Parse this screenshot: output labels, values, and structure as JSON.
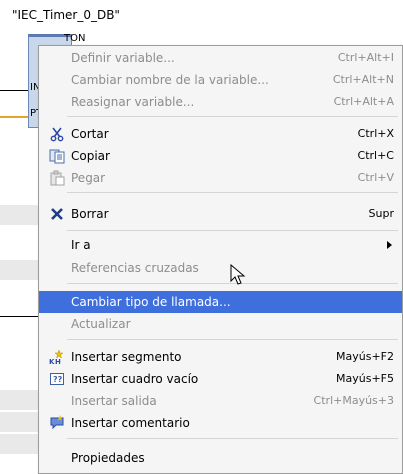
{
  "background": {
    "db_label": "\"IEC_Timer_0_DB\"",
    "block_title": "TON",
    "pin_in": "IN",
    "pin_pt": "PT"
  },
  "menu": {
    "items": [
      {
        "label": "Definir variable...",
        "shortcut": "Ctrl+Alt+I"
      },
      {
        "label": "Cambiar nombre de la variable...",
        "shortcut": "Ctrl+Alt+N"
      },
      {
        "label": "Reasignar variable...",
        "shortcut": "Ctrl+Alt+A"
      },
      {
        "label": "Cortar",
        "shortcut": "Ctrl+X"
      },
      {
        "label": "Copiar",
        "shortcut": "Ctrl+C"
      },
      {
        "label": "Pegar",
        "shortcut": "Ctrl+V"
      },
      {
        "label": "Borrar",
        "shortcut": "Supr"
      },
      {
        "label": "Ir a"
      },
      {
        "label": "Referencias cruzadas"
      },
      {
        "label": "Cambiar tipo de llamada..."
      },
      {
        "label": "Actualizar"
      },
      {
        "label": "Insertar segmento",
        "shortcut": "Mayús+F2"
      },
      {
        "label": "Insertar cuadro vacío",
        "shortcut": "Mayús+F5"
      },
      {
        "label": "Insertar salida",
        "shortcut": "Ctrl+Mayús+3"
      },
      {
        "label": "Insertar comentario"
      },
      {
        "label": "Propiedades"
      }
    ]
  },
  "colors": {
    "highlight": "#3f6fdc",
    "disabled_text": "#8d8d8d",
    "menu_background": "#f5f5f5"
  }
}
